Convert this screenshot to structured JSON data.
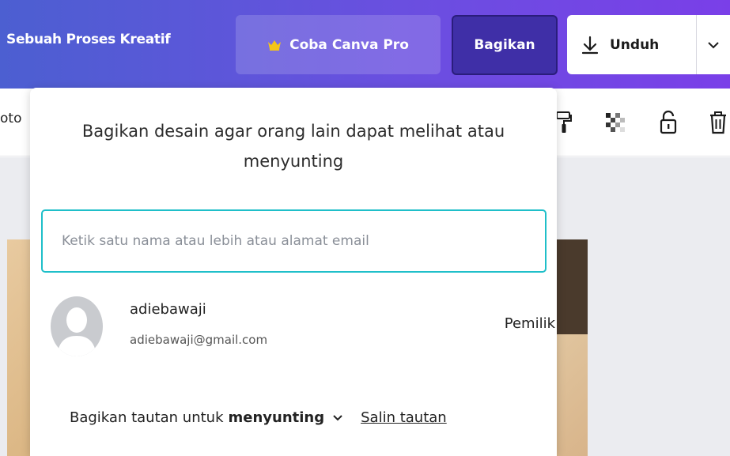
{
  "topbar": {
    "doc_title": "Sebuah Proses Kreatif",
    "pro_label": "Coba Canva Pro",
    "share_label": "Bagikan",
    "download_label": "Unduh",
    "gradient": [
      "#4c5fd1",
      "#7a3fe8"
    ],
    "crown_color": "#f5c518"
  },
  "toolbar": {
    "left_text": "oto",
    "icons": [
      "format-painter-icon",
      "transparency-icon",
      "lock-icon",
      "trash-icon"
    ]
  },
  "share_popover": {
    "title": "Bagikan desain agar orang lain dapat melihat atau menyunting",
    "input_placeholder": "Ketik satu nama atau lebih atau alamat email",
    "input_value": "",
    "accent_color": "#1fbfc9",
    "member": {
      "name": "adiebawaji",
      "email": "adiebawaji@gmail.com",
      "role": "Pemilik"
    },
    "link_prefix": "Bagikan tautan untuk",
    "link_mode": "menyunting",
    "copy_link_label": "Salin tautan"
  }
}
